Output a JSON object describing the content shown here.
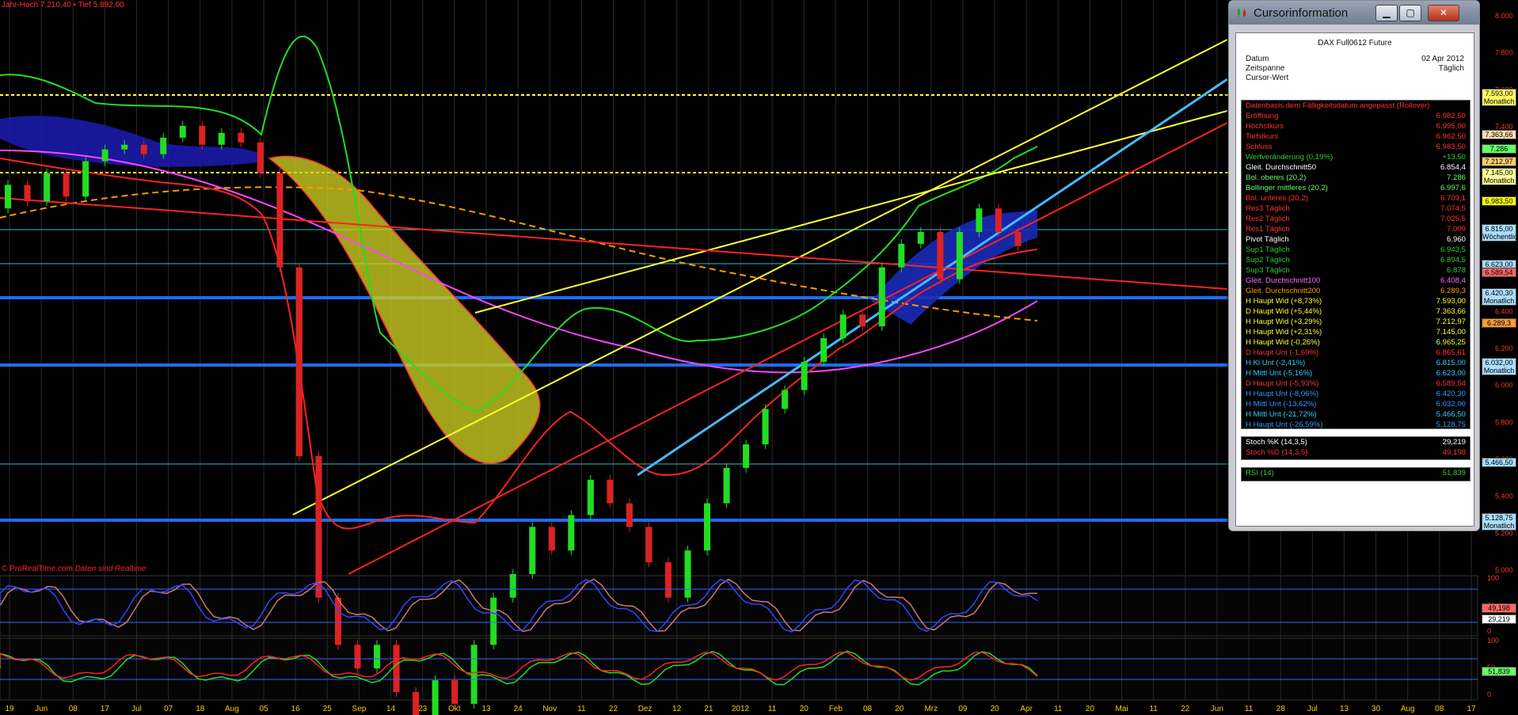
{
  "chart_header": {
    "text": "Jahr-Hoch 7.210,40 • Tief 5.892,00"
  },
  "watermark": {
    "source": "© ProRealTime.com",
    "note": "Daten sind Realtime"
  },
  "colors": {
    "background": "#000000",
    "candle_up": "#22dd22",
    "candle_down": "#dd2222",
    "axis_labels": "#ffcc00",
    "price_labels": "#ff3333"
  },
  "chart_data": {
    "type": "candlestick",
    "instrument": "DAX Full0612 Future",
    "ylim": [
      5600,
      8000
    ],
    "y_ticks": [
      "8.000",
      "7.800",
      "7.600",
      "7.400",
      "7.200",
      "7.000",
      "6.800",
      "6.600",
      "6.400",
      "6.200",
      "6.000",
      "5.800",
      "5.600",
      "5.400",
      "5.200",
      "5.000"
    ],
    "x_ticks": [
      "19",
      "Jun",
      "08",
      "17",
      "Jul",
      "07",
      "18",
      "Aug",
      "05",
      "16",
      "25",
      "Sep",
      "14",
      "23",
      "Okt",
      "13",
      "24",
      "Nov",
      "11",
      "22",
      "Dez",
      "12",
      "21",
      "2012",
      "11",
      "20",
      "Feb",
      "08",
      "20",
      "Mrz",
      "09",
      "20",
      "Apr",
      "11",
      "20",
      "Mai",
      "11",
      "22",
      "Jun",
      "11",
      "28",
      "Jul",
      "13",
      "30",
      "Aug",
      "08",
      "17"
    ],
    "price": [
      7150,
      7250,
      7180,
      7300,
      7200,
      7350,
      7400,
      7420,
      7380,
      7450,
      7500,
      7420,
      7470,
      7430,
      7300,
      6900,
      6100,
      5500,
      5300,
      5200,
      5300,
      5100,
      5000,
      5150,
      5050,
      5300,
      5500,
      5600,
      5800,
      5700,
      5850,
      6000,
      5900,
      5800,
      5650,
      5500,
      5700,
      5900,
      6050,
      6150,
      6300,
      6380,
      6500,
      6600,
      6700,
      6650,
      6900,
      7000,
      7050,
      6850,
      7050,
      7150,
      7050,
      6990
    ],
    "series": [
      {
        "name": "Gleit. Durchschnitt50",
        "color": "#ff66ff"
      },
      {
        "name": "Gleit. Durchschnitt200",
        "color": "#ff9900"
      },
      {
        "name": "Bol. oberes (20,2)",
        "color": "#22dd22"
      },
      {
        "name": "Bol. unteres (20,2)",
        "color": "#ff2222"
      }
    ],
    "horizontal_levels": [
      7593.0,
      7363.66,
      7212.97,
      7145.0,
      6965.25,
      6885.61,
      6815.0,
      6623.0,
      6589.54,
      6420.3,
      6032.0,
      5466.5,
      5128.75
    ],
    "stoch": {
      "ylim": [
        0,
        100
      ],
      "ticks": [
        "100",
        "50",
        "0"
      ],
      "k": 29.219,
      "d": 49.198
    },
    "rsi": {
      "ylim": [
        0,
        100
      ],
      "ticks": [
        "100",
        "50",
        "0"
      ],
      "value": 51.839
    }
  },
  "price_tags": [
    {
      "text": "7.593,00",
      "sub": "Monatlich",
      "bg": "#ffff66"
    },
    {
      "text": "7.363,66",
      "sub": "",
      "bg": "#ffe0b0"
    },
    {
      "text": "7.286",
      "sub": "",
      "bg": "#66ff66"
    },
    {
      "text": "7.212,97",
      "sub": "",
      "bg": "#ffcc66"
    },
    {
      "text": "7.145,00",
      "sub": "Monatlich",
      "bg": "#ffff99"
    },
    {
      "text": "6.983,50",
      "sub": "",
      "bg": "#ffff00"
    },
    {
      "text": "6.815,00",
      "sub": "Wöchentlich",
      "bg": "#aaddff"
    },
    {
      "text": "6.623,00",
      "sub": "",
      "bg": "#aaddff"
    },
    {
      "text": "6.589,54",
      "sub": "",
      "bg": "#ff6666"
    },
    {
      "text": "6.420,30",
      "sub": "Monatlich",
      "bg": "#aaddff"
    },
    {
      "text": "6.289,3",
      "sub": "",
      "bg": "#ff9933"
    },
    {
      "text": "6.032,00",
      "sub": "Monatlich",
      "bg": "#aaddff"
    },
    {
      "text": "5.466,50",
      "sub": "",
      "bg": "#aaddff"
    },
    {
      "text": "5.128,75",
      "sub": "Monatlich",
      "bg": "#aaddff"
    }
  ],
  "ind_tags": [
    {
      "text": "49,198",
      "bg": "#ff6666"
    },
    {
      "text": "29,219",
      "bg": "#ffffff"
    },
    {
      "text": "51,839",
      "bg": "#66ff66"
    }
  ],
  "cursor_panel": {
    "title": "Cursorinformation",
    "buttons": {
      "minimize": "▁",
      "maximize": "▢",
      "close": "✕"
    },
    "instrument": "DAX Full0612 Future",
    "datum_label": "Datum",
    "datum_value": "02 Apr 2012",
    "zeitspanne_label": "Zeitspanne",
    "zeitspanne_value": "Täglich",
    "cursor_label": "Cursor-Wert",
    "section_title": "Datenbasis dem Fälligkeitsdatum angepasst (Rollover)",
    "rows": [
      {
        "label": "Eröffnung",
        "value": "6.982,50",
        "color": "#ff3333"
      },
      {
        "label": "Höchstkurs",
        "value": "6.995,00",
        "color": "#ff3333"
      },
      {
        "label": "Tiefstkurs",
        "value": "6.962,50",
        "color": "#ff3333"
      },
      {
        "label": "Schluss",
        "value": "6.983,50",
        "color": "#ff3333"
      },
      {
        "label": "Wertveränderung (0,19%)",
        "value": "+13,50",
        "color": "#33cc33"
      },
      {
        "label": "Gleit. Durchschnitt50",
        "value": "6.854,4",
        "color": "#ffffff"
      },
      {
        "label": "Bol. oberes (20,2)",
        "value": "7.286",
        "color": "#66ff66"
      },
      {
        "label": "Bollinger mittleres (20,2)",
        "value": "6.997,6",
        "color": "#66ff66"
      },
      {
        "label": "Bol. unteres (20,2)",
        "value": "6.709,1",
        "color": "#ff3333"
      },
      {
        "label": "Res3 Täglich",
        "value": "7.074,5",
        "color": "#ff3333"
      },
      {
        "label": "Res2 Täglich",
        "value": "7.025,5",
        "color": "#ff3333"
      },
      {
        "label": "Res1 Täglich",
        "value": "7.009",
        "color": "#ff3333"
      },
      {
        "label": "Pivot Täglich",
        "value": "6.960",
        "color": "#ffffff"
      },
      {
        "label": "Sup1 Täglich",
        "value": "6.943,5",
        "color": "#33cc33"
      },
      {
        "label": "Sup2 Täglich",
        "value": "6.894,5",
        "color": "#33cc33"
      },
      {
        "label": "Sup3 Täglich",
        "value": "6.878",
        "color": "#33cc33"
      },
      {
        "label": "Gleit. Durchschnitt100",
        "value": "6.408,4",
        "color": "#ff66ff"
      },
      {
        "label": "Gleit. Durchschnitt200",
        "value": "6.289,3",
        "color": "#ff9900"
      },
      {
        "label": "H Haupt Wid (+8,73%)",
        "value": "7.593,00",
        "color": "#ffff33"
      },
      {
        "label": "D Haupt Wid (+5,44%)",
        "value": "7.363,66",
        "color": "#ffff33"
      },
      {
        "label": "H Haupt Wid (+3,29%)",
        "value": "7.212,97",
        "color": "#ffff33"
      },
      {
        "label": "H Haupt Wid (+2,31%)",
        "value": "7.145,00",
        "color": "#ffff33"
      },
      {
        "label": "H Haupt Wid (-0,26%)",
        "value": "6.965,25",
        "color": "#ffff33"
      },
      {
        "label": "D Haupt Unt (-1,69%)",
        "value": "6.865,61",
        "color": "#ff3333"
      },
      {
        "label": "H Kl Unt (-2,41%)",
        "value": "6.815,00",
        "color": "#33ccff"
      },
      {
        "label": "H Mittl Unt (-5,16%)",
        "value": "6.623,00",
        "color": "#33ccff"
      },
      {
        "label": "D Haupt Unt (-5,93%)",
        "value": "6.589,54",
        "color": "#ff3333"
      },
      {
        "label": "H Haupt Unt (-8,06%)",
        "value": "6.420,30",
        "color": "#3399ff"
      },
      {
        "label": "H Mittl Unt (-13,62%)",
        "value": "6.032,00",
        "color": "#3399ff"
      },
      {
        "label": "H Mittl Unt (-21,72%)",
        "value": "5.466,50",
        "color": "#33ccff"
      },
      {
        "label": "H Haupt Unt (-26,59%)",
        "value": "5.128,75",
        "color": "#3399ff"
      }
    ],
    "stoch_rows": [
      {
        "label": "Stoch %K (14,3,5)",
        "value": "29,219",
        "color": "#ffffff"
      },
      {
        "label": "Stoch %D (14,3,5)",
        "value": "49,198",
        "color": "#ff3333"
      }
    ],
    "rsi_row": {
      "label": "RSI (14)",
      "value": "51,839",
      "color": "#33cc33"
    }
  }
}
